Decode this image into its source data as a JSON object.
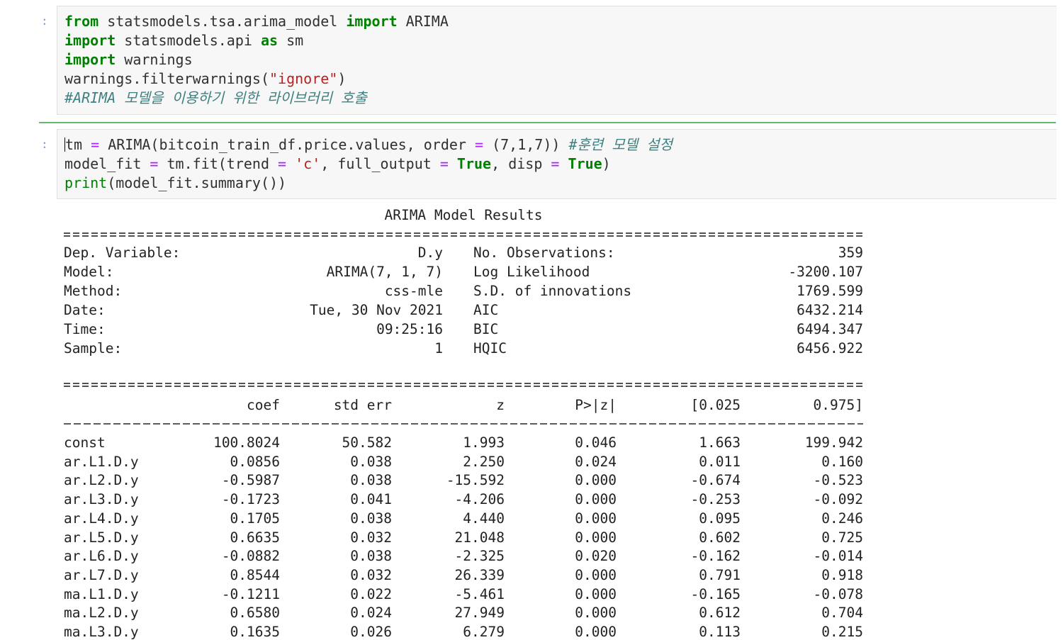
{
  "cell1": {
    "prompt": ":",
    "lines": [
      {
        "k1": "from",
        "t1": " statsmodels.tsa.arima_model ",
        "k2": "import",
        "t2": " ARIMA"
      },
      {
        "k1": "import",
        "t1": " statsmodels.api ",
        "k2": "as",
        "t2": " sm"
      },
      {
        "k1": "import",
        "t1": " warnings"
      },
      {
        "t1": "warnings.filterwarnings(",
        "s": "\"ignore\"",
        "t2": ")"
      },
      {
        "c": "#ARIMA 모델을 이용하기 위한 라이브러리 호출"
      }
    ]
  },
  "cell2": {
    "prompt": ":",
    "line1": {
      "a": "tm ",
      "op": "=",
      "b": " ARIMA(bitcoin_train_df.price.values, order ",
      "op2": "=",
      "c": " (7,1,7)) ",
      "cmt": "#훈련 모델 설정"
    },
    "line2": {
      "a": "model_fit ",
      "op": "=",
      "b": " tm.fit(trend ",
      "op2": "=",
      "s": " 'c'",
      "c": ", full_output ",
      "op3": "=",
      "k": " True",
      "d": ", disp ",
      "op4": "=",
      "k2": " True",
      "e": ")"
    },
    "line3": {
      "bi": "print",
      "a": "(model_fit.summary())"
    }
  },
  "output": {
    "title": "ARIMA Model Results",
    "info_left": [
      {
        "label": "Dep. Variable:",
        "value": "D.y"
      },
      {
        "label": "Model:",
        "value": "ARIMA(7, 1, 7)"
      },
      {
        "label": "Method:",
        "value": "css-mle"
      },
      {
        "label": "Date:",
        "value": "Tue, 30 Nov 2021"
      },
      {
        "label": "Time:",
        "value": "09:25:16"
      },
      {
        "label": "Sample:",
        "value": "1"
      }
    ],
    "info_right": [
      {
        "label": "No. Observations:",
        "value": "359"
      },
      {
        "label": "Log Likelihood",
        "value": "-3200.107"
      },
      {
        "label": "S.D. of innovations",
        "value": "1769.599"
      },
      {
        "label": "AIC",
        "value": "6432.214"
      },
      {
        "label": "BIC",
        "value": "6494.347"
      },
      {
        "label": "HQIC",
        "value": "6456.922"
      }
    ],
    "coef_headers": [
      "",
      "coef",
      "std err",
      "z",
      "P>|z|",
      "[0.025",
      "0.975]"
    ],
    "coef_rows": [
      [
        "const",
        "100.8024",
        "50.582",
        "1.993",
        "0.046",
        "1.663",
        "199.942"
      ],
      [
        "ar.L1.D.y",
        "0.0856",
        "0.038",
        "2.250",
        "0.024",
        "0.011",
        "0.160"
      ],
      [
        "ar.L2.D.y",
        "-0.5987",
        "0.038",
        "-15.592",
        "0.000",
        "-0.674",
        "-0.523"
      ],
      [
        "ar.L3.D.y",
        "-0.1723",
        "0.041",
        "-4.206",
        "0.000",
        "-0.253",
        "-0.092"
      ],
      [
        "ar.L4.D.y",
        "0.1705",
        "0.038",
        "4.440",
        "0.000",
        "0.095",
        "0.246"
      ],
      [
        "ar.L5.D.y",
        "0.6635",
        "0.032",
        "21.048",
        "0.000",
        "0.602",
        "0.725"
      ],
      [
        "ar.L6.D.y",
        "-0.0882",
        "0.038",
        "-2.325",
        "0.020",
        "-0.162",
        "-0.014"
      ],
      [
        "ar.L7.D.y",
        "0.8544",
        "0.032",
        "26.339",
        "0.000",
        "0.791",
        "0.918"
      ],
      [
        "ma.L1.D.y",
        "-0.1211",
        "0.022",
        "-5.461",
        "0.000",
        "-0.165",
        "-0.078"
      ],
      [
        "ma.L2.D.y",
        "0.6580",
        "0.024",
        "27.949",
        "0.000",
        "0.612",
        "0.704"
      ],
      [
        "ma.L3.D.y",
        "0.1635",
        "0.026",
        "6.279",
        "0.000",
        "0.113",
        "0.215"
      ]
    ]
  }
}
